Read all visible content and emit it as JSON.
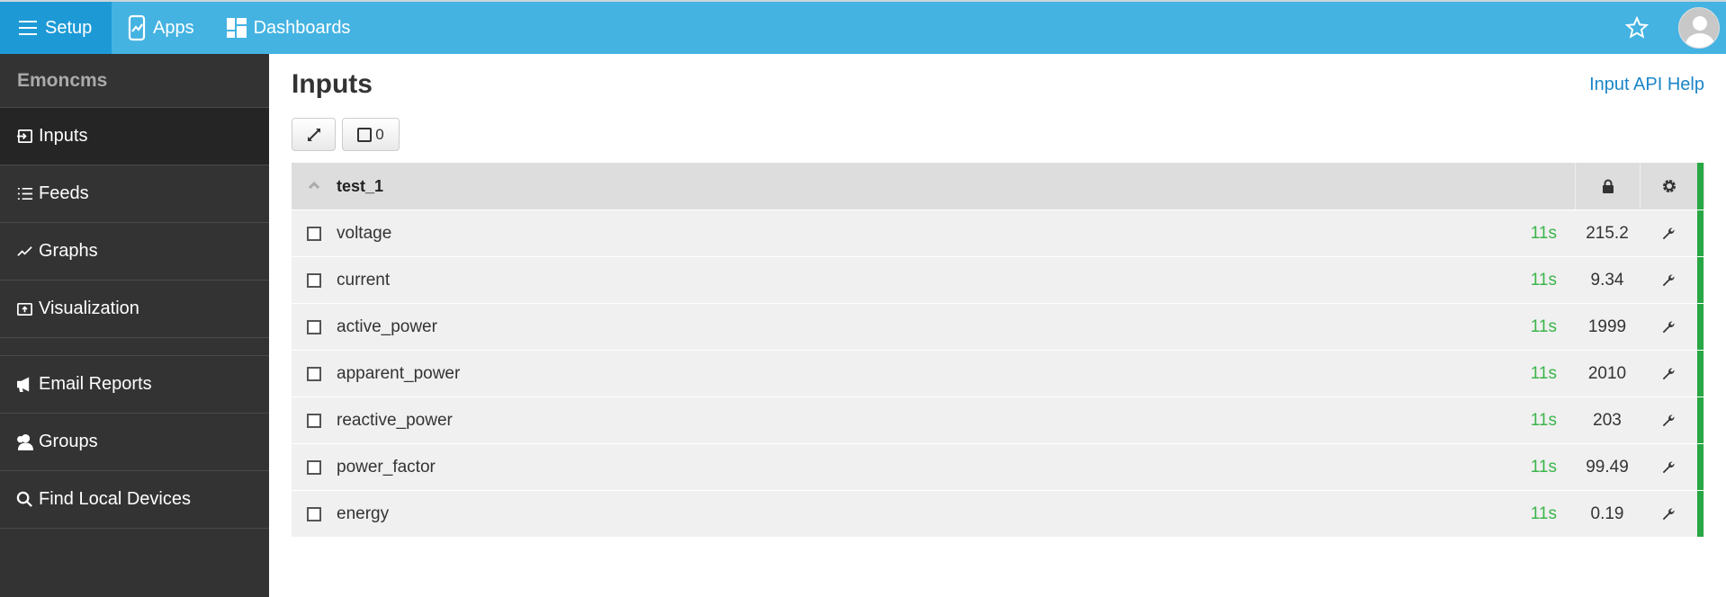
{
  "topbar": {
    "nav": [
      {
        "label": "Setup",
        "icon": "menu-icon",
        "active": true
      },
      {
        "label": "Apps",
        "icon": "mobile-chart-icon"
      },
      {
        "label": "Dashboards",
        "icon": "dashboard-icon"
      }
    ],
    "star_icon": "star-icon",
    "avatar_icon": "user-avatar-icon"
  },
  "sidebar": {
    "brand": "Emoncms",
    "items": [
      {
        "label": "Inputs",
        "icon": "input-icon",
        "active": true
      },
      {
        "label": "Feeds",
        "icon": "list-icon"
      },
      {
        "label": "Graphs",
        "icon": "graph-icon"
      },
      {
        "label": "Visualization",
        "icon": "visualization-icon"
      },
      {
        "label": "Email Reports",
        "icon": "megaphone-icon"
      },
      {
        "label": "Groups",
        "icon": "groups-icon"
      },
      {
        "label": "Find Local Devices",
        "icon": "search-icon"
      }
    ]
  },
  "main": {
    "title": "Inputs",
    "api_help": "Input API Help",
    "toolbar": {
      "selected_count": "0"
    },
    "group": {
      "name": "test_1",
      "status_color": "#28a745",
      "inputs": [
        {
          "name": "voltage",
          "time": "11s",
          "value": "215.2"
        },
        {
          "name": "current",
          "time": "11s",
          "value": "9.34"
        },
        {
          "name": "active_power",
          "time": "11s",
          "value": "1999"
        },
        {
          "name": "apparent_power",
          "time": "11s",
          "value": "2010"
        },
        {
          "name": "reactive_power",
          "time": "11s",
          "value": "203"
        },
        {
          "name": "power_factor",
          "time": "11s",
          "value": "99.49"
        },
        {
          "name": "energy",
          "time": "11s",
          "value": "0.19"
        }
      ]
    }
  }
}
